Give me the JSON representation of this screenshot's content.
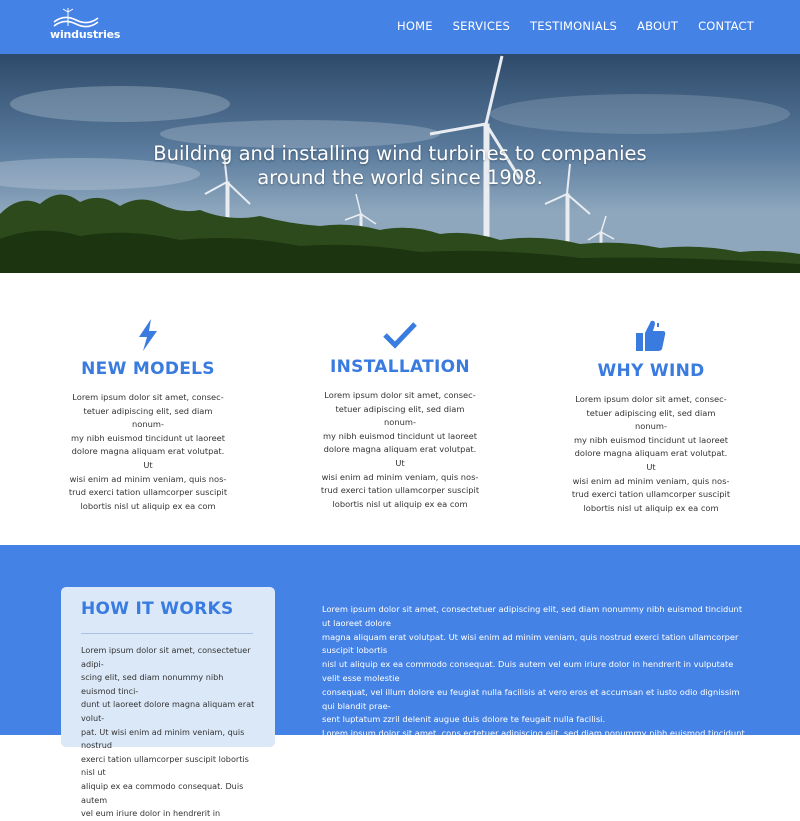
{
  "header": {
    "logo_text": "windustries",
    "nav": [
      "HOME",
      "SERVICES",
      "TESTIMONIALS",
      "ABOUT",
      "CONTACT"
    ]
  },
  "hero": {
    "title_line1": "Building and installing wind turbines to companies",
    "title_line2": "around the world since 1908."
  },
  "features": [
    {
      "icon": "lightning-icon",
      "title": "NEW MODELS",
      "lines": [
        "Lorem ipsum dolor sit amet, consec-",
        "tetuer adipiscing elit, sed diam nonum-",
        "my nibh euismod tincidunt ut laoreet",
        "dolore magna aliquam erat volutpat. Ut",
        "wisi enim ad minim veniam, quis nos-",
        "trud exerci tation ullamcorper suscipit",
        "lobortis nisl ut aliquip ex ea com"
      ]
    },
    {
      "icon": "checkmark-icon",
      "title": "INSTALLATION",
      "lines": [
        "Lorem ipsum dolor sit amet, consec-",
        "tetuer adipiscing elit, sed diam nonum-",
        "my nibh euismod tincidunt ut laoreet",
        "dolore magna aliquam erat volutpat. Ut",
        "wisi enim ad minim veniam, quis nos-",
        "trud exerci tation ullamcorper suscipit",
        "lobortis nisl ut aliquip ex ea com"
      ]
    },
    {
      "icon": "thumbs-up-icon",
      "title": "WHY WIND",
      "lines": [
        "Lorem ipsum dolor sit amet, consec-",
        "tetuer adipiscing elit, sed diam nonum-",
        "my nibh euismod tincidunt ut laoreet",
        "dolore magna aliquam erat volutpat. Ut",
        "wisi enim ad minim veniam, quis nos-",
        "trud exerci tation ullamcorper suscipit",
        "lobortis nisl ut aliquip ex ea com"
      ]
    }
  ],
  "how": {
    "title": "HOW IT WORKS",
    "card_lines": [
      "Lorem ipsum dolor sit amet, consectetuer adipi-",
      "scing elit, sed diam nonummy nibh euismod tinci-",
      "dunt ut laoreet dolore magna aliquam erat volut-",
      "pat. Ut wisi enim ad minim veniam, quis nostrud",
      "exerci tation ullamcorper suscipit lobortis nisl ut",
      "aliquip ex ea commodo consequat. Duis autem",
      "vel eum iriure dolor in hendrerit in"
    ],
    "body_lines": [
      "Lorem ipsum dolor sit amet, consectetuer adipiscing elit, sed diam nonummy nibh euismod tincidunt ut laoreet dolore",
      "magna aliquam erat volutpat. Ut wisi enim ad minim veniam, quis nostrud exerci tation ullamcorper suscipit lobortis",
      "nisl ut aliquip ex ea commodo consequat. Duis autem vel eum iriure dolor in hendrerit in vulputate velit esse molestie",
      "consequat, vel illum dolore eu feugiat nulla facilisis at vero eros et accumsan et iusto odio dignissim qui blandit prae-",
      "sent luptatum zzril delenit augue duis dolore te feugait nulla facilisi.",
      "Lorem ipsum dolor sit amet, cons ectetuer adipiscing elit, sed diam nonummy nibh euismod tincidunt ut laoreet"
    ]
  },
  "colors": {
    "brand_blue": "#4582e6",
    "heading_blue": "#3a7be0",
    "card_bg": "#dbe8f8"
  }
}
